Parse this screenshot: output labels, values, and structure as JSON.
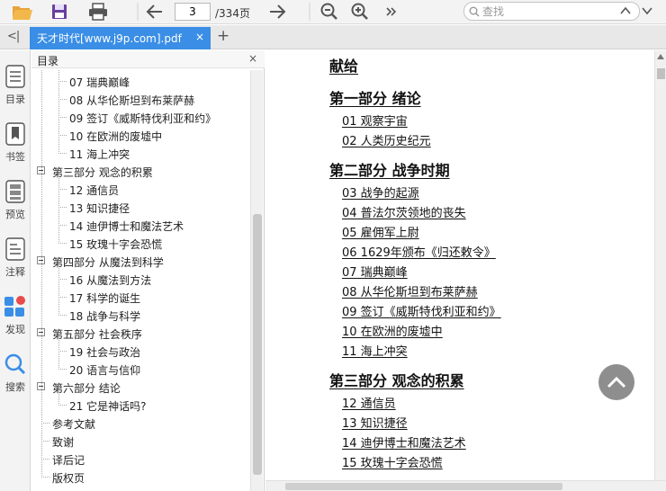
{
  "toolbar": {
    "page_current": "3",
    "page_total": "/334页",
    "search_placeholder": "查找"
  },
  "tab": {
    "title": "天才时代[www.j9p.com].pdf",
    "close": "×",
    "add": "+"
  },
  "rail": {
    "collapse": "<|",
    "items": [
      {
        "label": "目录",
        "icon": "list-icon"
      },
      {
        "label": "书签",
        "icon": "bookmark-icon"
      },
      {
        "label": "预览",
        "icon": "thumbnails-icon"
      },
      {
        "label": "注释",
        "icon": "note-icon"
      },
      {
        "label": "发现",
        "icon": "apps-icon"
      },
      {
        "label": "搜索",
        "icon": "search-icon"
      }
    ]
  },
  "outline": {
    "title": "目录",
    "close": "×",
    "rows": [
      {
        "text": "07 瑞典巅峰",
        "level": 1
      },
      {
        "text": "08 从华伦斯坦到布莱萨赫",
        "level": 1
      },
      {
        "text": "09 签订《威斯特伐利亚和约》",
        "level": 1
      },
      {
        "text": "10 在欧洲的废墟中",
        "level": 1
      },
      {
        "text": "11 海上冲突",
        "level": 1
      },
      {
        "text": "第三部分 观念的积累",
        "level": 0
      },
      {
        "text": "12 通信员",
        "level": 1
      },
      {
        "text": "13 知识捷径",
        "level": 1
      },
      {
        "text": "14 迪伊博士和魔法艺术",
        "level": 1
      },
      {
        "text": "15 玫瑰十字会恐慌",
        "level": 1
      },
      {
        "text": "第四部分 从魔法到科学",
        "level": 0
      },
      {
        "text": "16 从魔法到方法",
        "level": 1
      },
      {
        "text": "17 科学的诞生",
        "level": 1
      },
      {
        "text": "18 战争与科学",
        "level": 1
      },
      {
        "text": "第五部分 社会秩序",
        "level": 0
      },
      {
        "text": "19 社会与政治",
        "level": 1
      },
      {
        "text": "20 语言与信仰",
        "level": 1
      },
      {
        "text": "第六部分 结论",
        "level": 0
      },
      {
        "text": "21 它是神话吗?",
        "level": 1
      },
      {
        "text": "参考文献",
        "level": 2
      },
      {
        "text": "致谢",
        "level": 2
      },
      {
        "text": "译后记",
        "level": 2
      },
      {
        "text": "版权页",
        "level": 2
      }
    ]
  },
  "document": {
    "lines": [
      {
        "text": "献给",
        "kind": "h"
      },
      {
        "text": "第一部分 绪论",
        "kind": "h"
      },
      {
        "text": "01 观察宇宙",
        "kind": "s"
      },
      {
        "text": "02 人类历史纪元",
        "kind": "s"
      },
      {
        "text": "第二部分 战争时期",
        "kind": "h"
      },
      {
        "text": "03 战争的起源",
        "kind": "s"
      },
      {
        "text": "04 普法尔茨领地的丧失",
        "kind": "s"
      },
      {
        "text": "05 雇佣军上尉",
        "kind": "s"
      },
      {
        "text": "06 1629年颁布《归还敕令》",
        "kind": "s"
      },
      {
        "text": "07 瑞典巅峰",
        "kind": "s"
      },
      {
        "text": "08 从华伦斯坦到布莱萨赫",
        "kind": "s"
      },
      {
        "text": "09 签订《威斯特伐利亚和约》",
        "kind": "s"
      },
      {
        "text": "10 在欧洲的废墟中",
        "kind": "s"
      },
      {
        "text": "11 海上冲突",
        "kind": "s"
      },
      {
        "text": "第三部分 观念的积累",
        "kind": "h"
      },
      {
        "text": "12 通信员",
        "kind": "s"
      },
      {
        "text": "13 知识捷径",
        "kind": "s"
      },
      {
        "text": "14 迪伊博士和魔法艺术",
        "kind": "s"
      },
      {
        "text": "15 玫瑰十字会恐慌",
        "kind": "s"
      }
    ]
  },
  "colors": {
    "accent": "#3a8ee6",
    "toolbar_icon": "#555555",
    "open_folder": "#e8a33a",
    "save": "#6a3fa0",
    "discover_blue": "#3a8ee6",
    "discover_red": "#e84b4b"
  }
}
